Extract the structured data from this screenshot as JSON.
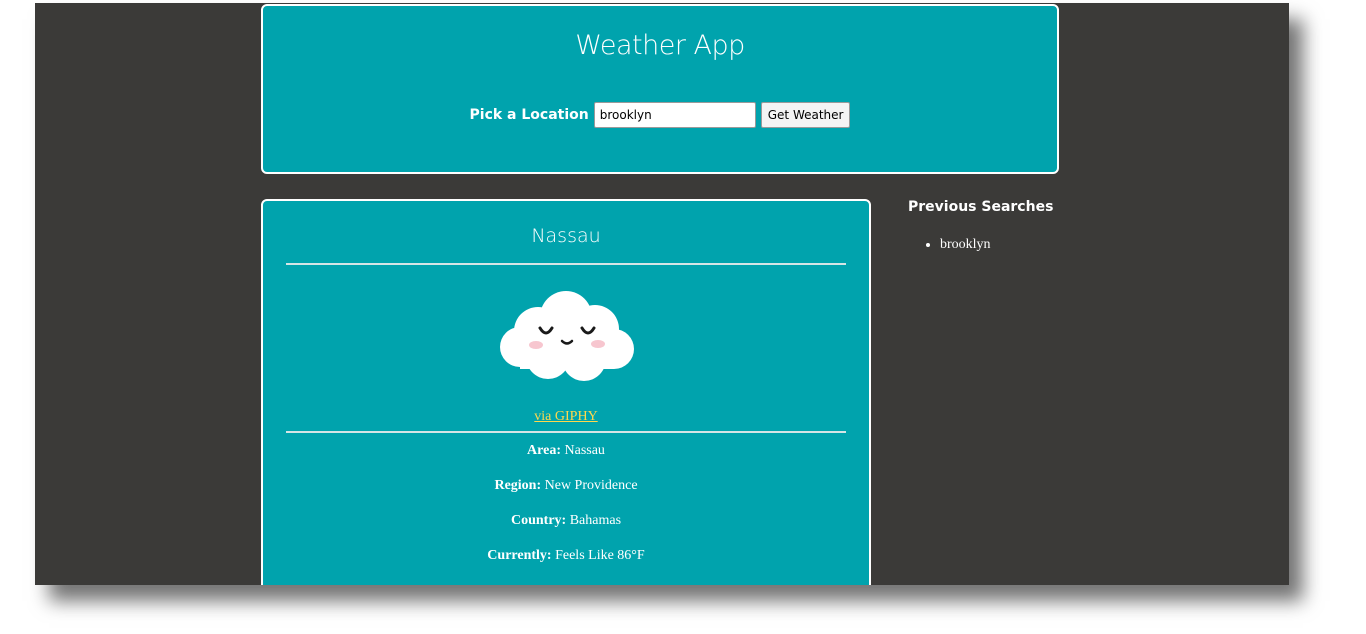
{
  "header": {
    "title": "Weather App",
    "search_label": "Pick a Location",
    "search_value": "brooklyn",
    "button_label": "Get Weather"
  },
  "weather": {
    "city": "Nassau",
    "icon": "cloud-icon",
    "giphy_label": "via GIPHY",
    "details": [
      {
        "label": "Area:",
        "value": "Nassau"
      },
      {
        "label": "Region:",
        "value": "New Providence"
      },
      {
        "label": "Country:",
        "value": "Bahamas"
      },
      {
        "label": "Currently:",
        "value": "Feels Like 86°F"
      }
    ]
  },
  "history": {
    "title": "Previous Searches",
    "items": [
      "brooklyn"
    ]
  },
  "colors": {
    "background": "#3b3a38",
    "card": "#00a3ad",
    "link": "#ffd84d"
  }
}
